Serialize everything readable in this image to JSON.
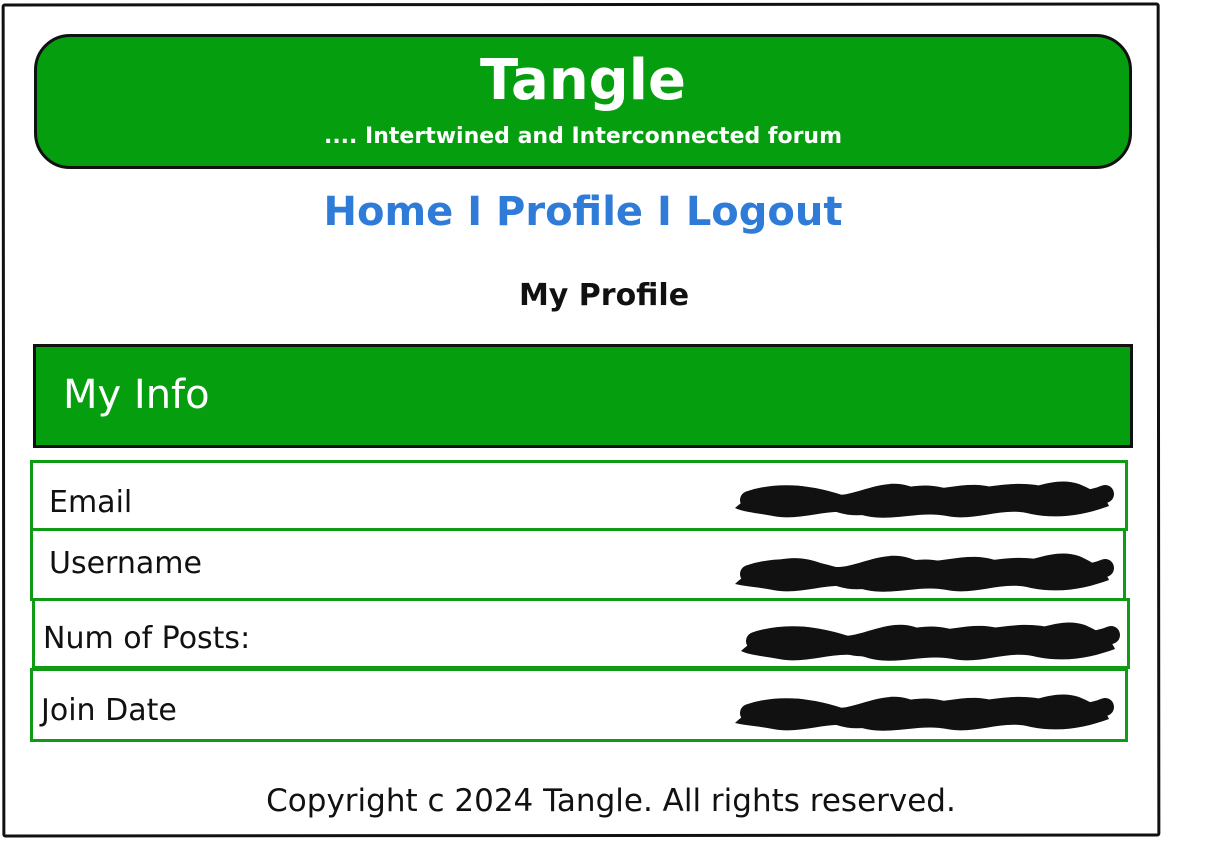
{
  "banner": {
    "title": "Tangle",
    "tagline": ".... Intertwined and Interconnected forum",
    "background_color": "#049e0e"
  },
  "nav": {
    "items": [
      {
        "label": "Home"
      },
      {
        "label": "Profile"
      },
      {
        "label": "Logout"
      }
    ],
    "separator": "I",
    "link_color": "#2f7bd8"
  },
  "page": {
    "title": "My Profile"
  },
  "info_section": {
    "title": "My Info",
    "rows": [
      {
        "label": "Email",
        "value_state": "redacted"
      },
      {
        "label": "Username",
        "value_state": "redacted"
      },
      {
        "label": "Num of Posts:",
        "value_state": "redacted"
      },
      {
        "label": "Join Date",
        "value_state": "redacted"
      }
    ],
    "row_border_color": "#109a16"
  },
  "footer": {
    "text": "Copyright c 2024 Tangle. All rights reserved."
  }
}
